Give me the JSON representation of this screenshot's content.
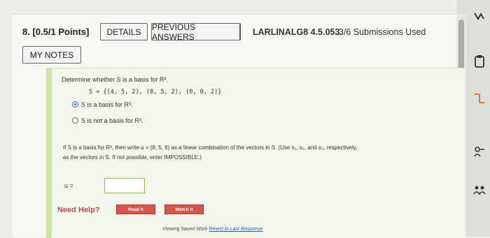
{
  "question": {
    "number": "8.",
    "points": "[0.5/1 Points]",
    "details_label": "DETAILS",
    "previous_answers_label": "PREVIOUS ANSWERS",
    "code": "LARLINALG8 4.5.053.",
    "submissions": "3/6 Submissions Used",
    "my_notes_label": "MY NOTES"
  },
  "problem": {
    "prompt": "Determine whether S is a basis for R³.",
    "set": "S = {(4, 5, 2), (0, 5, 2), (0, 0, 2)}",
    "options": [
      {
        "label": "S is a basis for R³.",
        "selected": true
      },
      {
        "label": "S is not a basis for R³.",
        "selected": false
      }
    ],
    "instruction_line1": "If S is a basis for R³, then write u = (8, 5, 6) as a linear combination of the vectors in S. (Use s₁, s₂, and s₃, respectively,",
    "instruction_line2": "as the vectors in S. If not possible, enter IMPOSSIBLE.)",
    "u_label": "u =",
    "u_value": ""
  },
  "help": {
    "label": "Need Help?",
    "read_label": "Read It",
    "watch_label": "Watch It"
  },
  "footer": {
    "viewing": "Viewing Saved Work",
    "revert": "Revert to Last Response"
  },
  "colors": {
    "accent_green": "#cfe2a3",
    "radio_selected": "#2f6fd0",
    "help_red": "#c0504d"
  },
  "side_icons": [
    "chevron-icon",
    "clipboard-icon",
    "folder-icon",
    "share-icon",
    "people-icon"
  ]
}
